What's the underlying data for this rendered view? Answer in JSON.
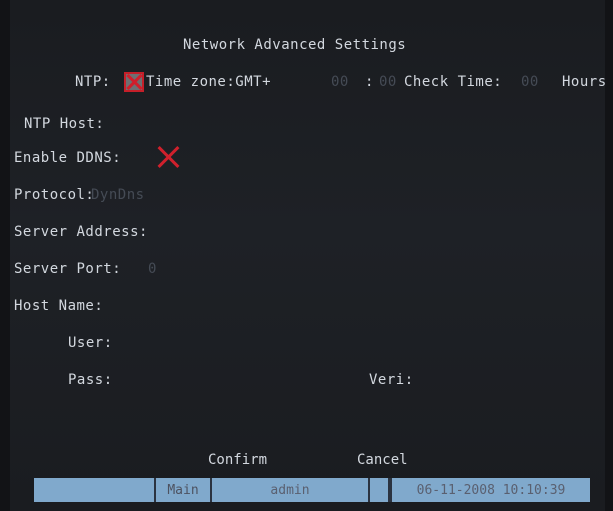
{
  "title": "Network Advanced Settings",
  "ntp": {
    "label": "NTP:",
    "checked": true,
    "timezone_label": "Time zone:GMT+",
    "tz_hours": "00",
    "tz_sep": ":",
    "tz_minutes": "00",
    "check_time_label": "Check Time:",
    "check_time_value": "00",
    "hours_label": "Hours",
    "host_label": "NTP Host:"
  },
  "ddns": {
    "enable_label": "Enable DDNS:",
    "enabled": false,
    "protocol_label": "Protocol:",
    "protocol_value": "DynDns",
    "server_address_label": "Server Address:",
    "server_port_label": "Server Port:",
    "server_port_value": "0",
    "host_name_label": "Host Name:",
    "user_label": "User:",
    "pass_label": "Pass:",
    "verify_label": "Veri:"
  },
  "buttons": {
    "confirm": "Confirm",
    "cancel": "Cancel"
  },
  "statusbar": {
    "menu": "Main",
    "user": "admin",
    "datetime": "06-11-2008 10:10:39"
  },
  "colors": {
    "background": "#1c1e23",
    "label": "#d3d8df",
    "value_dim": "#454b55",
    "accent_red": "#d0202c",
    "statusbar": "#80a9cc"
  }
}
